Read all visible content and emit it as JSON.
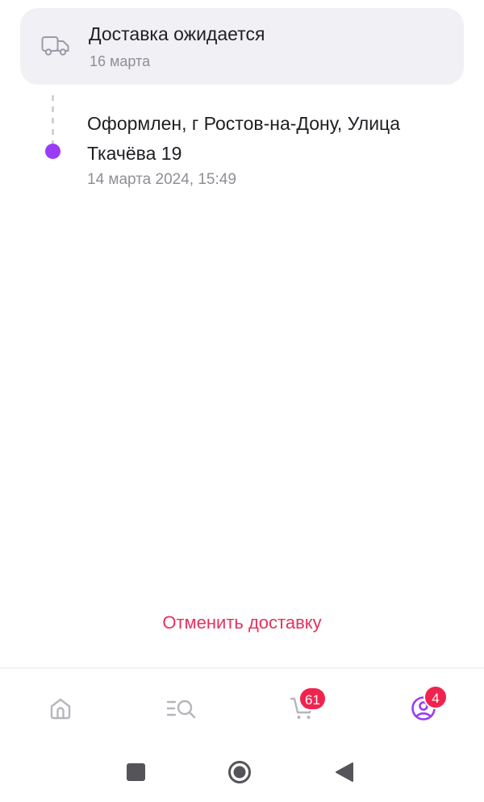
{
  "delivery_card": {
    "icon": "truck-icon",
    "title": "Доставка ожидается",
    "date": "16 марта"
  },
  "timeline": [
    {
      "text": "Оформлен, г Ростов-на-Дону, Улица Ткачёва 19",
      "timestamp": "14 марта 2024, 15:49",
      "dot_color": "#9a3cf5"
    }
  ],
  "cancel_button": {
    "label": "Отменить доставку",
    "color": "#e5325e"
  },
  "bottom_nav": {
    "items": [
      {
        "name": "home",
        "icon": "home-icon",
        "active": false
      },
      {
        "name": "catalog",
        "icon": "catalog-search-icon",
        "active": false
      },
      {
        "name": "cart",
        "icon": "cart-icon",
        "active": false,
        "badge": "61"
      },
      {
        "name": "profile",
        "icon": "profile-icon",
        "active": true,
        "badge": "4"
      }
    ],
    "active_color": "#9a3cf5",
    "inactive_color": "#b5b5bd",
    "badge_color": "#f0234f"
  },
  "system_nav": {
    "buttons": [
      "recents-icon",
      "home-circle-icon",
      "back-triangle-icon"
    ]
  }
}
